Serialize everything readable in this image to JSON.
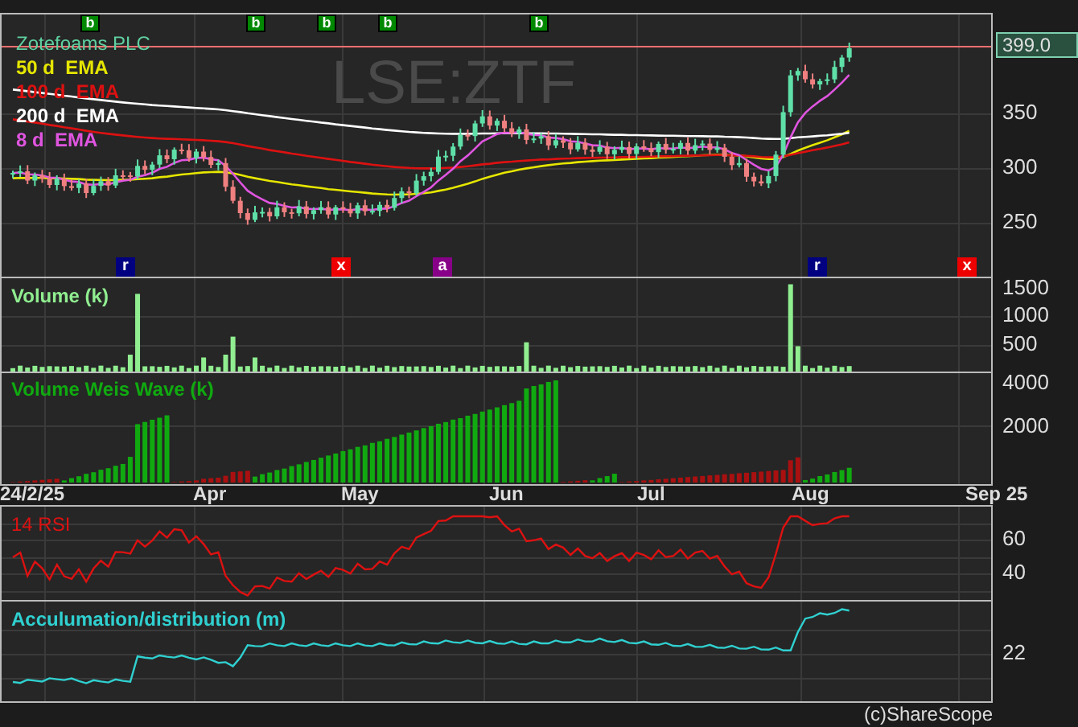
{
  "price_panel": {
    "title": "Zotefoams PLC",
    "watermark": "LSE:ZTF",
    "last_price": "399.0",
    "legend": [
      {
        "label": "50 d  EMA",
        "color": "#e6e600"
      },
      {
        "label": "100 d  EMA",
        "color": "#dd1111"
      },
      {
        "label": "200 d  EMA",
        "color": "#ffffff"
      },
      {
        "label": "8 d  EMA",
        "color": "#e055e0"
      }
    ],
    "y_ticks": [
      "350",
      "300",
      "250"
    ],
    "top_markers": [
      {
        "label": "b"
      },
      {
        "label": "b"
      },
      {
        "label": "b"
      },
      {
        "label": "b"
      },
      {
        "label": "b"
      }
    ],
    "bottom_markers": [
      {
        "label": "r",
        "color": "#000080"
      },
      {
        "label": "x",
        "color": "#ee0000"
      },
      {
        "label": "a",
        "color": "#880088"
      },
      {
        "label": "r",
        "color": "#000080"
      },
      {
        "label": "x",
        "color": "#ee0000"
      }
    ]
  },
  "volume_panel": {
    "title": "Volume (k)",
    "y_ticks": [
      "1500",
      "1000",
      "500"
    ]
  },
  "weis_panel": {
    "title": "Volume Weis Wave (k)",
    "y_ticks": [
      "4000",
      "2000"
    ]
  },
  "x_axis": [
    "24/2/25",
    "Apr",
    "May",
    "Jun",
    "Jul",
    "Aug",
    "Sep 25"
  ],
  "rsi_panel": {
    "title": "14 RSI",
    "y_ticks": [
      "60",
      "40"
    ]
  },
  "ad_panel": {
    "title": "Acculumation/distribution (m)",
    "y_ticks": [
      "22"
    ]
  },
  "footer": "(c)ShareScope"
}
